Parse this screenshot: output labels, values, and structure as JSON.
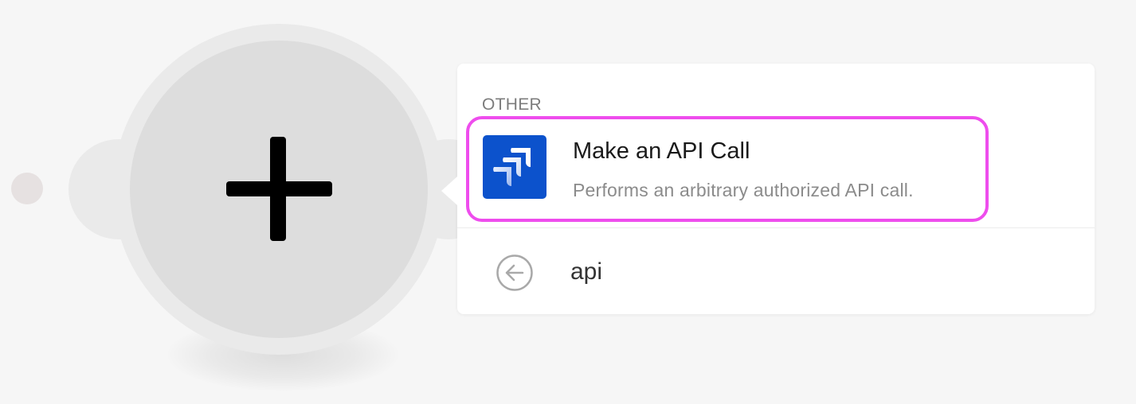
{
  "popup": {
    "section_label": "OTHER",
    "results": [
      {
        "title": "Make an API Call",
        "description": "Performs an arbitrary authorized API call.",
        "icon": "jira-logo-icon",
        "icon_bg": "#0c52cc",
        "highlight_color": "#ee4ded"
      }
    ],
    "search": {
      "back_icon": "arrow-left-circle-icon",
      "value": "api"
    }
  },
  "canvas": {
    "node_icon": "plus-icon"
  }
}
